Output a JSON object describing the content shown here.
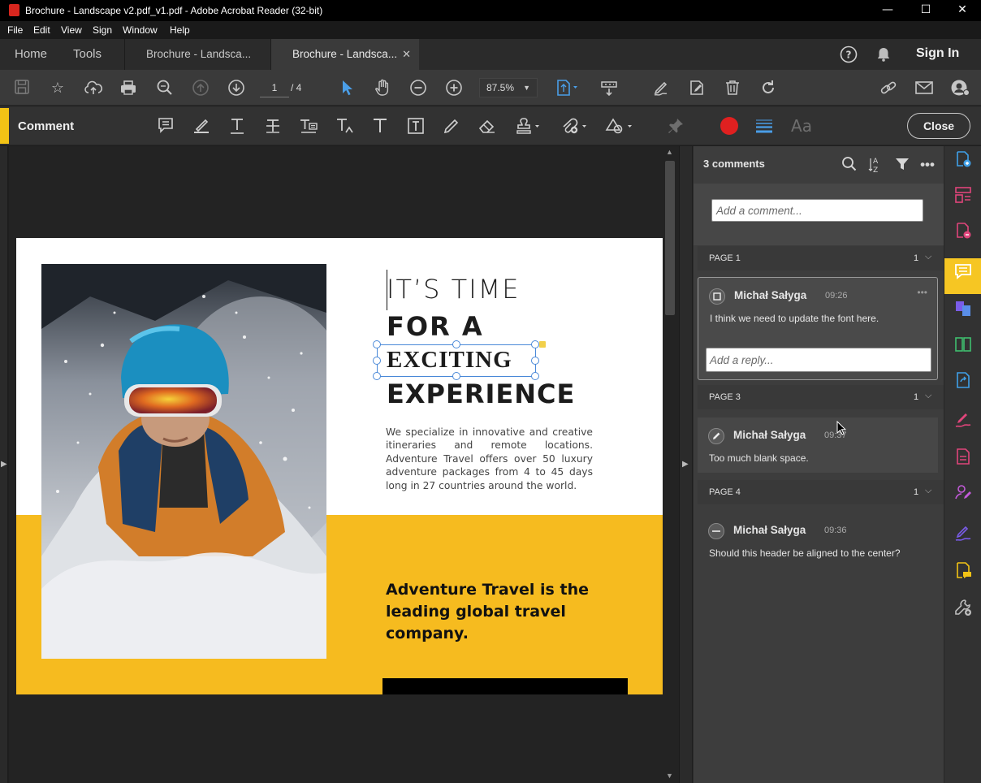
{
  "window": {
    "title": "Brochure - Landscape v2.pdf_v1.pdf - Adobe Acrobat Reader (32-bit)",
    "controls": {
      "minimize": "—",
      "maximize": "☐",
      "close": "✕"
    }
  },
  "menu": [
    "File",
    "Edit",
    "View",
    "Sign",
    "Window",
    "Help"
  ],
  "tabs": {
    "home": "Home",
    "tools": "Tools",
    "docs": [
      {
        "label": "Brochure - Landsca..."
      },
      {
        "label": "Brochure - Landsca...",
        "close": "✕"
      }
    ],
    "sign_in": "Sign In"
  },
  "toolbar": {
    "page_current": "1",
    "page_total": "/ 4",
    "zoom": "87.5%"
  },
  "comment_toolbar": {
    "label": "Comment",
    "close": "Close"
  },
  "document": {
    "heading_line1": "IT’S TIME",
    "heading_line2": "FOR A",
    "heading_line3": "EXCITING",
    "heading_line4": "EXPERIENCE",
    "body": "We specialize in innovative and creative itineraries and remote locations. Adventure Travel offers over 50 luxury adventure packages from 4 to 45 days long in 27 countries around the world.",
    "tagline": "Adventure Travel is the leading global travel company."
  },
  "comments_panel": {
    "count": "3 comments",
    "add_placeholder": "Add a comment...",
    "groups": [
      {
        "page": "PAGE 1",
        "count": "1",
        "author": "Michał Sałyga",
        "time": "09:26",
        "text": "I think we need to update the font here.",
        "reply_placeholder": "Add a reply..."
      },
      {
        "page": "PAGE 3",
        "count": "1",
        "author": "Michał Sałyga",
        "time": "09:37",
        "text": "Too much blank space."
      },
      {
        "page": "PAGE 4",
        "count": "1",
        "author": "Michał Sałyga",
        "time": "09:36",
        "text": "Should this header be aligned to the center?"
      }
    ]
  },
  "colors": {
    "accent_yellow": "#f6bb1f",
    "selection_blue": "#4a89d8",
    "record_red": "#e02020"
  }
}
